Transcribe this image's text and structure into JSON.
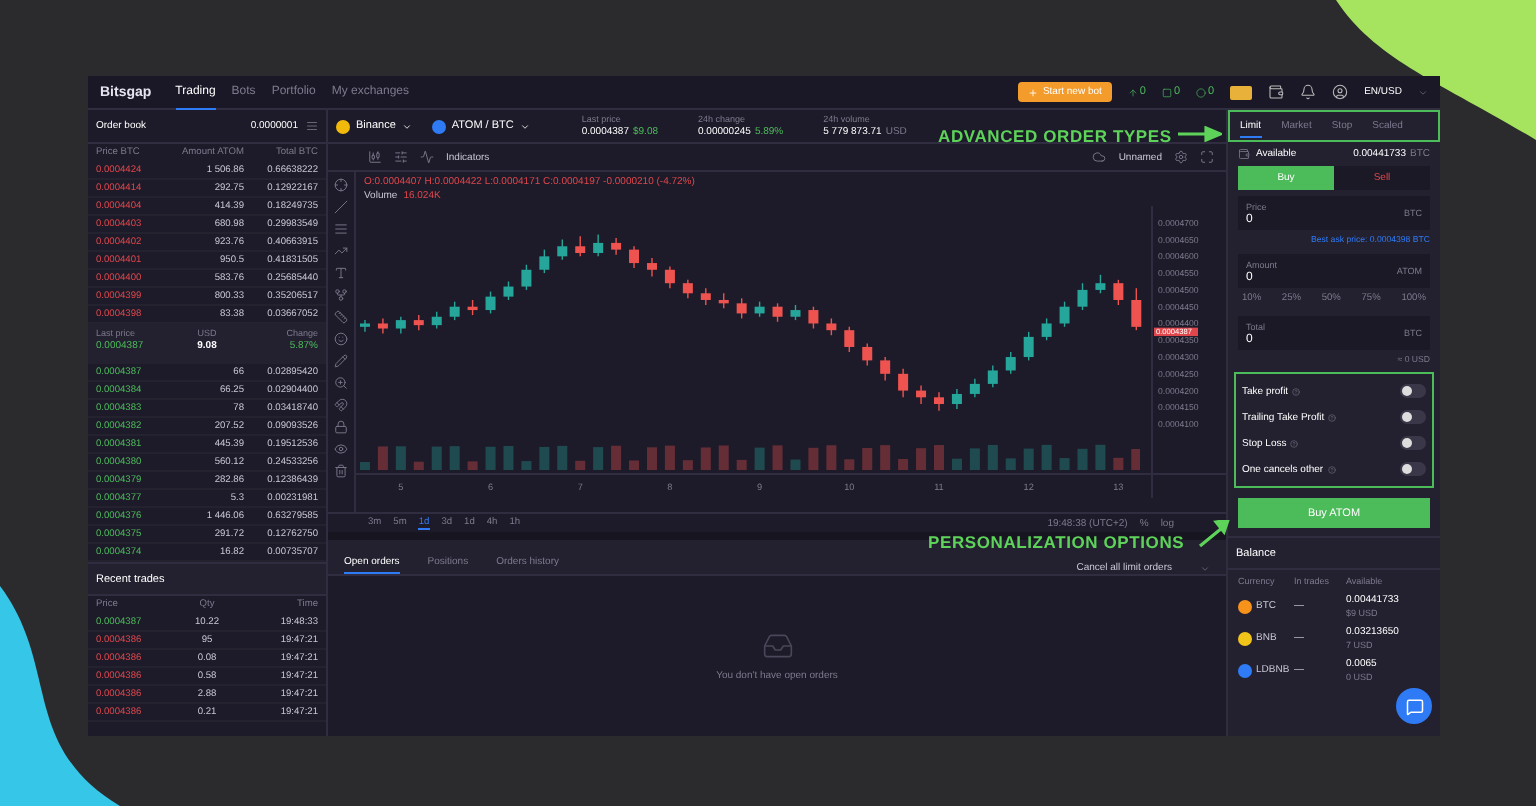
{
  "nav": {
    "logo": "Bitsgap",
    "tabs": [
      {
        "label": "Trading",
        "selected": true
      },
      {
        "label": "Bots",
        "selected": false
      },
      {
        "label": "Portfolio",
        "selected": false
      },
      {
        "label": "My exchanges",
        "selected": false
      }
    ],
    "bot_button": "Start new bot",
    "counters": [
      {
        "kind": "up",
        "value": "0"
      },
      {
        "kind": "square",
        "value": "0"
      },
      {
        "kind": "dot",
        "value": "0"
      }
    ],
    "locale": "EN/USD"
  },
  "order_book": {
    "title": "Order book",
    "step": "0.0000001",
    "columns": [
      "Price BTC",
      "Amount ATOM",
      "Total BTC"
    ],
    "asks": [
      [
        "0.0004424",
        "1 506.86",
        "0.66638222"
      ],
      [
        "0.0004414",
        "292.75",
        "0.12922167"
      ],
      [
        "0.0004404",
        "414.39",
        "0.18249735"
      ],
      [
        "0.0004403",
        "680.98",
        "0.29983549"
      ],
      [
        "0.0004402",
        "923.76",
        "0.40663915"
      ],
      [
        "0.0004401",
        "950.5",
        "0.41831505"
      ],
      [
        "0.0004400",
        "583.76",
        "0.25685440"
      ],
      [
        "0.0004399",
        "800.33",
        "0.35206517"
      ],
      [
        "0.0004398",
        "83.38",
        "0.03667052"
      ]
    ],
    "last": {
      "label": "Last price",
      "value": "0.0004387",
      "usd_label": "USD",
      "usd": "9.08",
      "change_label": "Change",
      "change": "5.87%"
    },
    "bids": [
      [
        "0.0004387",
        "66",
        "0.02895420"
      ],
      [
        "0.0004384",
        "66.25",
        "0.02904400"
      ],
      [
        "0.0004383",
        "78",
        "0.03418740"
      ],
      [
        "0.0004382",
        "207.52",
        "0.09093526"
      ],
      [
        "0.0004381",
        "445.39",
        "0.19512536"
      ],
      [
        "0.0004380",
        "560.12",
        "0.24533256"
      ],
      [
        "0.0004379",
        "282.86",
        "0.12386439"
      ],
      [
        "0.0004377",
        "5.3",
        "0.00231981"
      ],
      [
        "0.0004376",
        "1 446.06",
        "0.63279585"
      ],
      [
        "0.0004375",
        "291.72",
        "0.12762750"
      ],
      [
        "0.0004374",
        "16.82",
        "0.00735707"
      ]
    ]
  },
  "recent_trades": {
    "title": "Recent trades",
    "columns": [
      "Price",
      "Qty",
      "Time"
    ],
    "rows": [
      {
        "kind": "buy",
        "price": "0.0004387",
        "qty": "10.22",
        "time": "19:48:33"
      },
      {
        "kind": "sell",
        "price": "0.0004386",
        "qty": "95",
        "time": "19:47:21"
      },
      {
        "kind": "sell",
        "price": "0.0004386",
        "qty": "0.08",
        "time": "19:47:21"
      },
      {
        "kind": "sell",
        "price": "0.0004386",
        "qty": "0.58",
        "time": "19:47:21"
      },
      {
        "kind": "sell",
        "price": "0.0004386",
        "qty": "2.88",
        "time": "19:47:21"
      },
      {
        "kind": "sell",
        "price": "0.0004386",
        "qty": "0.21",
        "time": "19:47:21"
      }
    ]
  },
  "market": {
    "exchange": "Binance",
    "pair": "ATOM / BTC",
    "stats": [
      {
        "label": "Last price",
        "value": "0.0004387",
        "extra": "$9.08"
      },
      {
        "label": "24h change",
        "value": "0.00000245",
        "extra": "5.89%"
      },
      {
        "label": "24h volume",
        "value": "5 779 873.71",
        "extra": "USD"
      }
    ]
  },
  "chart": {
    "indicators": "Indicators",
    "layout": "Unnamed",
    "ohlc": "O:0.0004407 H:0.0004422 L:0.0004171 C:0.0004197 -0.0000210 (-4.72%)",
    "volume_label": "Volume",
    "volume": "16.024K",
    "current_price": "0.0004387",
    "chart_data": {
      "type": "candlestick",
      "x": [
        4.6,
        4.8,
        5.0,
        5.2,
        5.4,
        5.6,
        5.8,
        6.0,
        6.2,
        6.4,
        6.6,
        6.8,
        7.0,
        7.2,
        7.4,
        7.6,
        7.8,
        8.0,
        8.2,
        8.4,
        8.6,
        8.8,
        9.0,
        9.2,
        9.4,
        9.6,
        9.8,
        10.0,
        10.2,
        10.4,
        10.6,
        10.8,
        11.0,
        11.2,
        11.4,
        11.6,
        11.8,
        12.0,
        12.2,
        12.4,
        12.6,
        12.8,
        13.0,
        13.2
      ],
      "xlim": [
        4.5,
        14.2
      ],
      "ohlc": [
        [
          0.000439,
          0.000441,
          0.0004375,
          0.00044
        ],
        [
          0.00044,
          0.0004415,
          0.000437,
          0.0004385
        ],
        [
          0.0004385,
          0.000442,
          0.000437,
          0.000441
        ],
        [
          0.000441,
          0.0004425,
          0.000438,
          0.0004395
        ],
        [
          0.0004395,
          0.0004435,
          0.0004385,
          0.000442
        ],
        [
          0.000442,
          0.0004465,
          0.000441,
          0.000445
        ],
        [
          0.000445,
          0.000447,
          0.0004425,
          0.000444
        ],
        [
          0.000444,
          0.0004495,
          0.000443,
          0.000448
        ],
        [
          0.000448,
          0.0004525,
          0.000447,
          0.000451
        ],
        [
          0.000451,
          0.0004575,
          0.00045,
          0.000456
        ],
        [
          0.000456,
          0.000462,
          0.000455,
          0.00046
        ],
        [
          0.00046,
          0.000465,
          0.000459,
          0.000463
        ],
        [
          0.000463,
          0.000466,
          0.00046,
          0.000461
        ],
        [
          0.000461,
          0.0004665,
          0.00046,
          0.000464
        ],
        [
          0.000464,
          0.0004655,
          0.0004605,
          0.000462
        ],
        [
          0.000462,
          0.000463,
          0.0004565,
          0.000458
        ],
        [
          0.000458,
          0.0004595,
          0.000454,
          0.000456
        ],
        [
          0.000456,
          0.000457,
          0.0004505,
          0.000452
        ],
        [
          0.000452,
          0.000453,
          0.0004475,
          0.000449
        ],
        [
          0.000449,
          0.0004505,
          0.0004455,
          0.000447
        ],
        [
          0.000447,
          0.000449,
          0.0004445,
          0.000446
        ],
        [
          0.000446,
          0.0004475,
          0.0004415,
          0.000443
        ],
        [
          0.000443,
          0.0004465,
          0.000442,
          0.000445
        ],
        [
          0.000445,
          0.000446,
          0.0004405,
          0.000442
        ],
        [
          0.000442,
          0.0004455,
          0.000441,
          0.000444
        ],
        [
          0.000444,
          0.000445,
          0.0004385,
          0.00044
        ],
        [
          0.00044,
          0.0004415,
          0.0004365,
          0.000438
        ],
        [
          0.000438,
          0.000439,
          0.0004315,
          0.000433
        ],
        [
          0.000433,
          0.000434,
          0.0004275,
          0.000429
        ],
        [
          0.000429,
          0.00043,
          0.000423,
          0.000425
        ],
        [
          0.000425,
          0.0004265,
          0.000418,
          0.00042
        ],
        [
          0.00042,
          0.0004215,
          0.000416,
          0.000418
        ],
        [
          0.000418,
          0.0004195,
          0.000414,
          0.000416
        ],
        [
          0.000416,
          0.0004205,
          0.0004145,
          0.000419
        ],
        [
          0.000419,
          0.0004235,
          0.000418,
          0.000422
        ],
        [
          0.000422,
          0.0004275,
          0.000421,
          0.000426
        ],
        [
          0.000426,
          0.0004315,
          0.000425,
          0.00043
        ],
        [
          0.00043,
          0.0004375,
          0.000429,
          0.000436
        ],
        [
          0.000436,
          0.0004415,
          0.000435,
          0.00044
        ],
        [
          0.00044,
          0.0004465,
          0.000439,
          0.000445
        ],
        [
          0.000445,
          0.000452,
          0.000444,
          0.00045
        ],
        [
          0.00045,
          0.0004545,
          0.000449,
          0.000452
        ],
        [
          0.000452,
          0.000453,
          0.0004455,
          0.000447
        ],
        [
          0.000447,
          0.0004505,
          0.000438,
          0.000439
        ]
      ],
      "ylim": [
        0.000388,
        0.000475
      ],
      "yticks": [
        {
          "value": 0.00047,
          "label": "0.0004700"
        },
        {
          "value": 0.000465,
          "label": "0.0004650"
        },
        {
          "value": 0.00046,
          "label": "0.0004600"
        },
        {
          "value": 0.000455,
          "label": "0.0004550"
        },
        {
          "value": 0.00045,
          "label": "0.0004500"
        },
        {
          "value": 0.000445,
          "label": "0.0004450"
        },
        {
          "value": 0.00044,
          "label": "0.0004400"
        },
        {
          "value": 0.000435,
          "label": "0.0004350"
        },
        {
          "value": 0.00043,
          "label": "0.0004300"
        },
        {
          "value": 0.000425,
          "label": "0.0004250"
        },
        {
          "value": 0.00042,
          "label": "0.0004200"
        },
        {
          "value": 0.000415,
          "label": "0.0004150"
        },
        {
          "value": 0.00041,
          "label": "0.0004100"
        }
      ],
      "xticks": [
        5,
        6,
        7,
        8,
        9,
        10,
        11,
        12,
        13
      ]
    },
    "timeframes": [
      {
        "label": "3m",
        "selected": false
      },
      {
        "label": "5m",
        "selected": false
      },
      {
        "label": "1d",
        "selected": true
      },
      {
        "label": "3d",
        "selected": false
      },
      {
        "label": "1d",
        "selected": false
      },
      {
        "label": "4h",
        "selected": false
      },
      {
        "label": "1h",
        "selected": false
      }
    ],
    "clock": "19:48:38 (UTC+2)",
    "percent": "%",
    "log": "log"
  },
  "orders": {
    "tabs": [
      {
        "label": "Open orders",
        "selected": true
      },
      {
        "label": "Positions",
        "selected": false
      },
      {
        "label": "Orders history",
        "selected": false
      }
    ],
    "cancel": "Cancel all limit orders",
    "empty": "You don't have open orders"
  },
  "order_form": {
    "tabs": [
      {
        "label": "Limit",
        "selected": true
      },
      {
        "label": "Market",
        "selected": false
      },
      {
        "label": "Stop",
        "selected": false
      },
      {
        "label": "Scaled",
        "selected": false
      }
    ],
    "available_label": "Available",
    "available": "0.00441733",
    "available_unit": "BTC",
    "sides": [
      {
        "label": "Buy",
        "kind": "buy",
        "selected": true
      },
      {
        "label": "Sell",
        "kind": "sell",
        "selected": false
      }
    ],
    "fields": [
      {
        "label": "Price",
        "value": "0",
        "unit": "BTC"
      },
      {
        "label": "Amount",
        "value": "0",
        "unit": "ATOM"
      },
      {
        "label": "Total",
        "value": "0",
        "unit": "BTC"
      }
    ],
    "best_ask": "Best ask price: 0.0004398 BTC",
    "percents": [
      "10%",
      "25%",
      "50%",
      "75%",
      "100%"
    ],
    "approx": "≈ 0 USD",
    "options": [
      {
        "label": "Take profit",
        "on": false
      },
      {
        "label": "Trailing Take Profit",
        "on": false
      },
      {
        "label": "Stop Loss",
        "on": false
      },
      {
        "label": "One cancels other",
        "on": false
      }
    ],
    "submit": "Buy ATOM"
  },
  "balance": {
    "title": "Balance",
    "columns": [
      "Currency",
      "In trades",
      "Available"
    ],
    "rows": [
      {
        "currency": "BTC",
        "color": "#f7931a",
        "in_trades": "—",
        "available": "0.00441733",
        "usd": "$9 USD"
      },
      {
        "currency": "BNB",
        "color": "#f0c419",
        "in_trades": "—",
        "available": "0.03213650",
        "usd": "7 USD"
      },
      {
        "currency": "LDBNB",
        "color": "#2f7bf5",
        "in_trades": "—",
        "available": "0.0065",
        "usd": "0 USD"
      }
    ]
  },
  "annotations": [
    {
      "kind": "order_types",
      "text": "ADVANCED ORDER TYPES"
    },
    {
      "kind": "personalization",
      "text": "PERSONALIZATION OPTIONS"
    }
  ]
}
